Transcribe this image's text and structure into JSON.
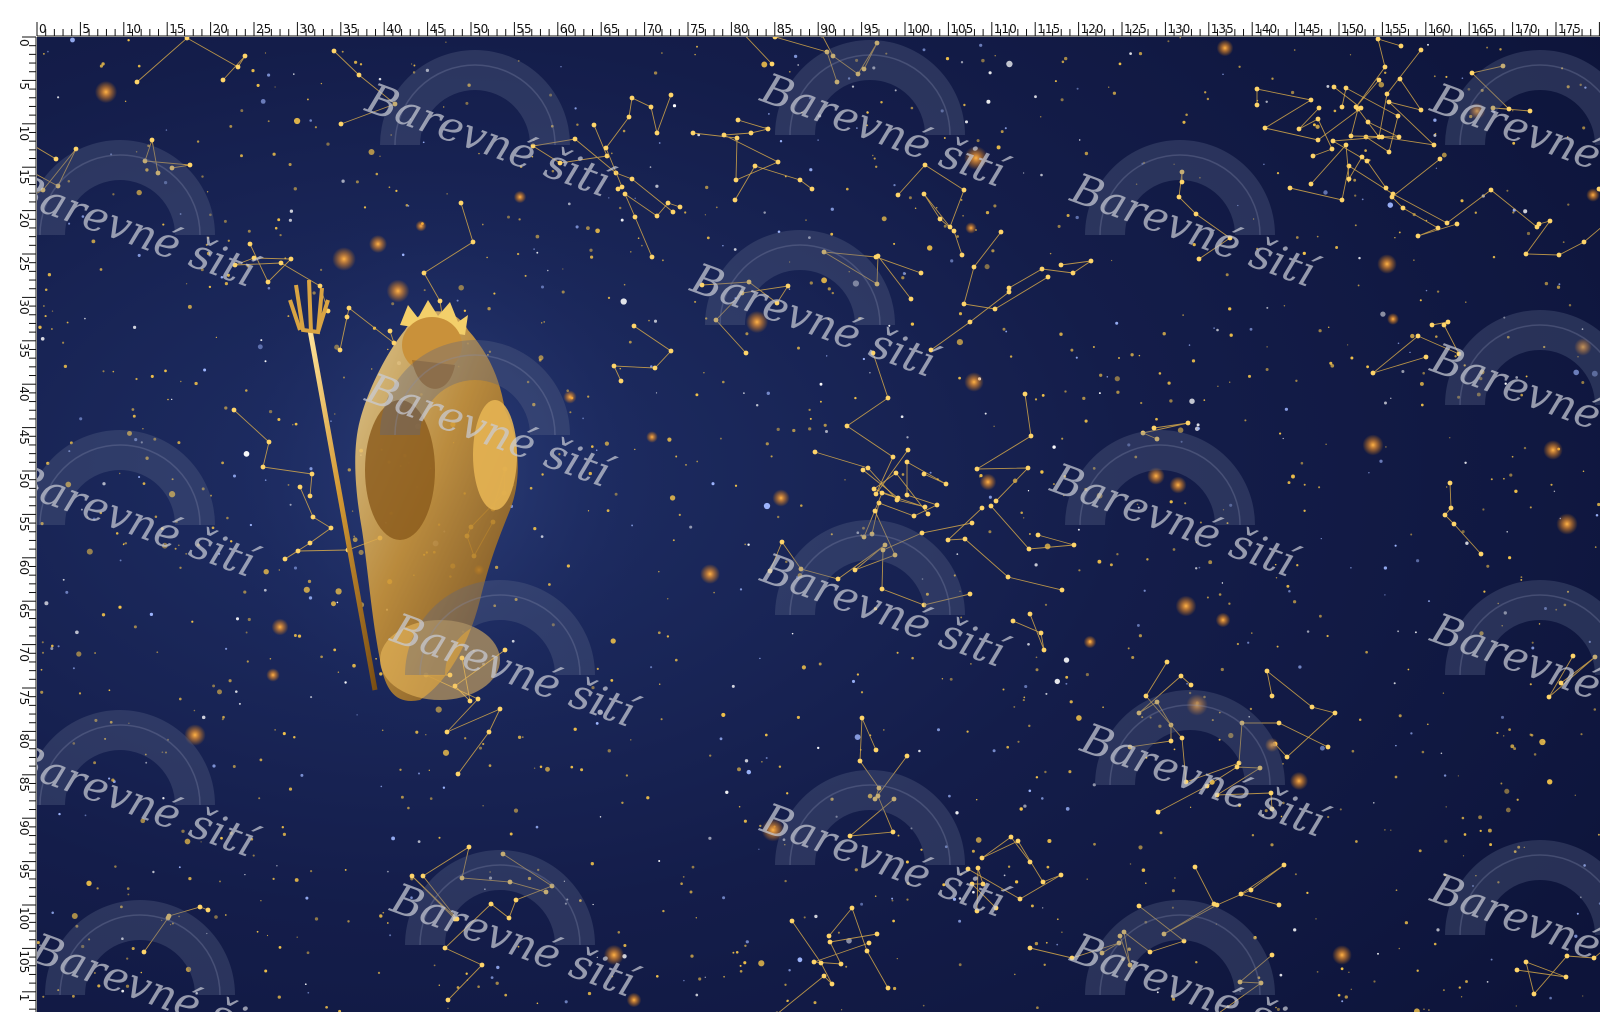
{
  "ruler": {
    "unit": "cm",
    "top_labels": [
      "0",
      "5",
      "10",
      "15",
      "20",
      "25",
      "30",
      "35",
      "40",
      "45",
      "50",
      "55",
      "60",
      "65",
      "70",
      "75",
      "80",
      "85",
      "90",
      "95",
      "100",
      "105",
      "110",
      "115",
      "120",
      "125",
      "130",
      "135",
      "140",
      "145",
      "150",
      "155",
      "160",
      "165",
      "170",
      "175"
    ],
    "left_labels": [
      "0",
      "5",
      "10",
      "15",
      "20",
      "25",
      "30",
      "35",
      "40",
      "45",
      "50",
      "55",
      "60",
      "65",
      "70",
      "75",
      "80",
      "85",
      "90",
      "95",
      "100",
      "105",
      "1"
    ]
  },
  "fabric": {
    "background_color": "#121b44",
    "star_color": "#f2c24a",
    "constellation_color": "#e0b04a",
    "figure": "golden-god-with-trident",
    "watermark_text": "Barevné šití"
  }
}
